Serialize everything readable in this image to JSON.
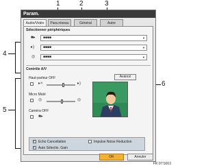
{
  "window": {
    "title": "Param."
  },
  "tabs": [
    {
      "label": "Audio/Vidéo",
      "active": true
    },
    {
      "label": "Para.réseau",
      "active": false
    },
    {
      "label": "Général",
      "active": false
    },
    {
      "label": "Autre",
      "active": false
    }
  ],
  "peripherals": {
    "heading": "Sélectionner périphériques",
    "selects": [
      {
        "icon": "camera-icon",
        "value": "■■■■"
      },
      {
        "icon": "speaker-icon",
        "value": "■■■■"
      },
      {
        "icon": "microphone-icon",
        "value": "■■■■"
      }
    ]
  },
  "av_control": {
    "heading": "Contrôle A/V",
    "advanced_button": "Avancé",
    "speaker_off_label": "Haut-parleur OFF",
    "mic_mute_label": "Micro Muté",
    "camera_off_label": "Caméra OFF",
    "speaker_level": 0.55,
    "mic_level": 0.5
  },
  "options": {
    "echo": "Echo Cancellation",
    "impulse": "Impulse Noise Reduction",
    "agc": "Auto Sélectio. Gain"
  },
  "footer_buttons": {
    "ok": "OK",
    "cancel": "Annuler"
  },
  "callouts": [
    "1",
    "2",
    "3",
    "4",
    "5",
    "6"
  ],
  "figure_code": "FR DTS003",
  "colors": {
    "ok_button": "#f3b133",
    "titlebar": "#3a3a3a",
    "preview_bg": "#2f8a55"
  }
}
